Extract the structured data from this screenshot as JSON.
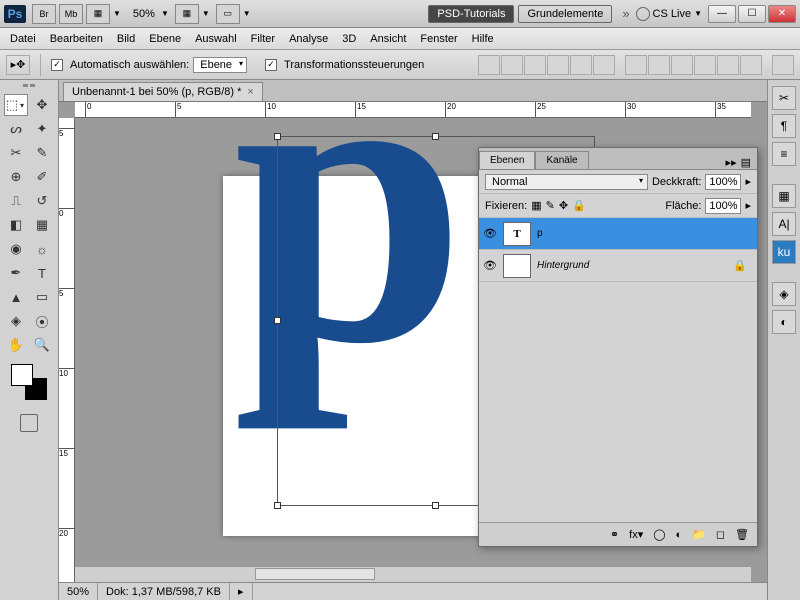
{
  "titlebar": {
    "zoom": "50%",
    "pill1": "PSD-Tutorials",
    "pill2": "Grundelemente",
    "cslive": "CS Live",
    "br": "Br",
    "mb": "Mb"
  },
  "menu": [
    "Datei",
    "Bearbeiten",
    "Bild",
    "Ebene",
    "Auswahl",
    "Filter",
    "Analyse",
    "3D",
    "Ansicht",
    "Fenster",
    "Hilfe"
  ],
  "options": {
    "autoSelect": "Automatisch auswählen:",
    "layer": "Ebene",
    "transform": "Transformationssteuerungen"
  },
  "doc": {
    "tab": "Unbenannt-1 bei 50% (p, RGB/8) *",
    "letter": "p"
  },
  "status": {
    "zoom": "50%",
    "docinfo": "Dok: 1,37 MB/598,7 KB"
  },
  "layers": {
    "tab1": "Ebenen",
    "tab2": "Kanäle",
    "blend": "Normal",
    "opacityLabel": "Deckkraft:",
    "opacity": "100%",
    "lockLabel": "Fixieren:",
    "fillLabel": "Fläche:",
    "fill": "100%",
    "items": [
      {
        "name": "p",
        "thumb": "T"
      },
      {
        "name": "Hintergrund",
        "thumb": ""
      }
    ]
  },
  "ruler_h": [
    0,
    5,
    10,
    15,
    20,
    25,
    30,
    35
  ],
  "ruler_v": [
    5,
    0,
    5,
    10,
    15,
    20
  ]
}
